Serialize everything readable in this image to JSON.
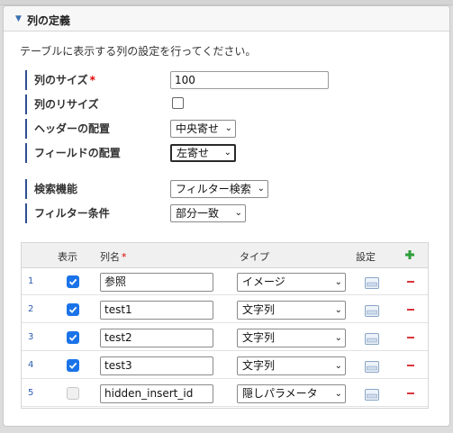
{
  "panel": {
    "title": "列の定義",
    "description": "テーブルに表示する列の設定を行ってください。"
  },
  "form": {
    "column_size": {
      "label": "列のサイズ",
      "required_mark": "*",
      "value": "100"
    },
    "column_resize": {
      "label": "列のリサイズ",
      "checked": false
    },
    "header_alignment": {
      "label": "ヘッダーの配置",
      "value": "中央寄せ"
    },
    "field_alignment": {
      "label": "フィールドの配置",
      "value": "左寄せ"
    },
    "search_function": {
      "label": "検索機能",
      "value": "フィルター検索"
    },
    "filter_condition": {
      "label": "フィルター条件",
      "value": "部分一致"
    }
  },
  "grid": {
    "headers": {
      "display": "表示",
      "column_name": "列名",
      "required_mark": "*",
      "type": "タイプ",
      "settings": "設定"
    },
    "rows": [
      {
        "num": "1",
        "checked": true,
        "name": "参照",
        "type": "イメージ"
      },
      {
        "num": "2",
        "checked": true,
        "name": "test1",
        "type": "文字列"
      },
      {
        "num": "3",
        "checked": true,
        "name": "test2",
        "type": "文字列"
      },
      {
        "num": "4",
        "checked": true,
        "name": "test3",
        "type": "文字列"
      },
      {
        "num": "5",
        "checked": false,
        "name": "hidden_insert_id",
        "type": "隠しパラメータ"
      }
    ]
  },
  "colors": {
    "accent": "#1a73e8",
    "label_bar": "#2f4f8f",
    "add_icon": "#2e9d3a",
    "delete_icon": "#d9363e"
  },
  "icons": {
    "collapse": "triangle-down-icon",
    "add": "plus-icon",
    "delete": "minus-icon",
    "settings": "window-settings-icon"
  }
}
